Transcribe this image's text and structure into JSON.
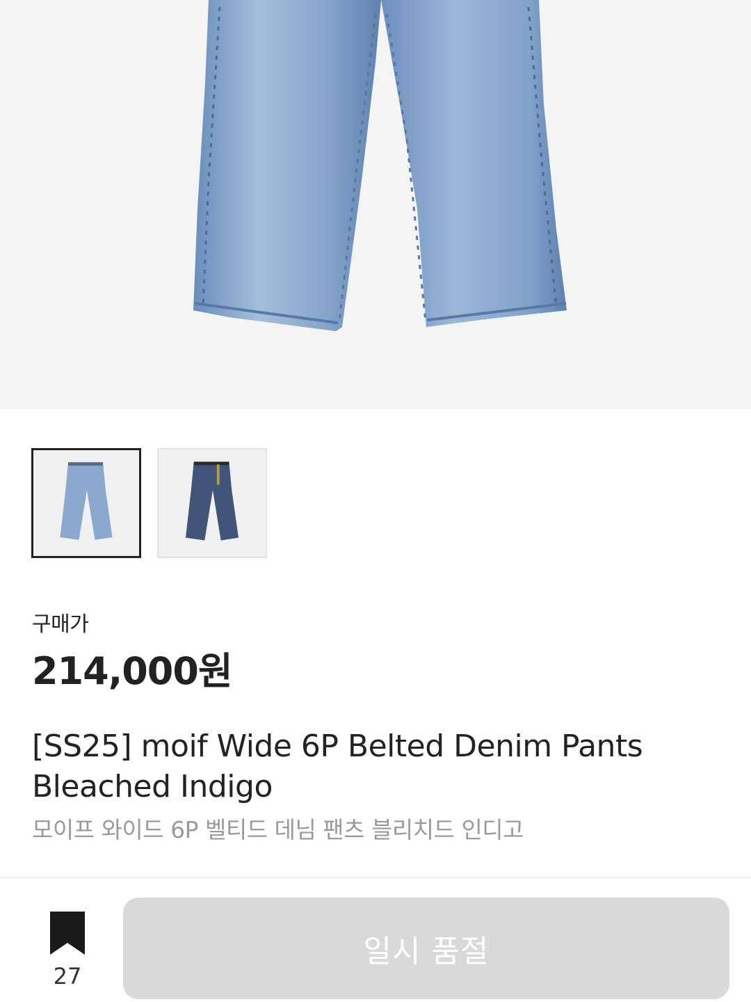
{
  "product": {
    "price_label": "구매가",
    "price": "214,000원",
    "name_en": "[SS25] moif Wide 6P Belted Denim Pants Bleached Indigo",
    "name_ko": "모이프 와이드 6P 벨티드 데님 팬츠 블리치드 인디고"
  },
  "thumbnails": [
    {
      "name": "light-wash-denim",
      "selected": true
    },
    {
      "name": "dark-wash-denim",
      "selected": false
    }
  ],
  "bottom_bar": {
    "bookmark_icon": "bookmark-icon",
    "bookmark_count": "27",
    "cta_label": "일시 품절"
  },
  "colors": {
    "hero_background": "#f4f4f4",
    "denim_light": "#7f9fc6",
    "denim_dark": "#3d5176",
    "cta_disabled": "#d9d9d9",
    "text_primary": "#222222",
    "text_secondary": "#9a9a9a"
  }
}
